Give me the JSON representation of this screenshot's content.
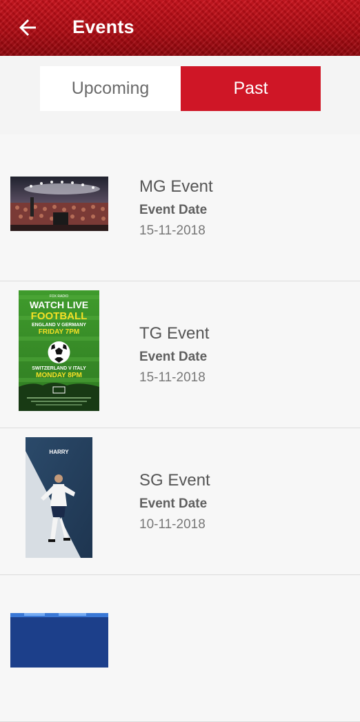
{
  "header": {
    "title": "Events",
    "back_icon": "arrow-back-icon",
    "accent": "#c8101a"
  },
  "tabs": [
    {
      "label": "Upcoming",
      "selected": false
    },
    {
      "label": "Past",
      "selected": true
    }
  ],
  "events": [
    {
      "name": "MG Event",
      "date_label": "Event Date",
      "date": "15-11-2018",
      "image": "concert-crowd-image"
    },
    {
      "name": "TG Event",
      "date_label": "Event Date",
      "date": "15-11-2018",
      "image": "football-poster-image",
      "poster": {
        "top": "FOX RADIO",
        "line1": "WATCH LIVE",
        "line2": "FOOTBALL",
        "match1": "ENGLAND V GERMANY",
        "time1": "FRIDAY 7PM",
        "match2": "SWITZERLAND V ITALY",
        "time2": "MONDAY 8PM"
      }
    },
    {
      "name": "SG Event",
      "date_label": "Event Date",
      "date": "10-11-2018",
      "image": "football-player-image",
      "poster": {
        "top": "HARRY"
      }
    }
  ]
}
